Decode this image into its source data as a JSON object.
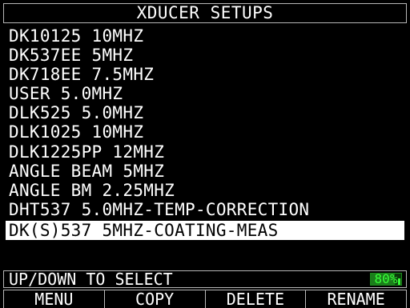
{
  "header": {
    "title": "XDUCER SETUPS"
  },
  "setups": {
    "items": [
      {
        "label": "DK10125 10MHZ"
      },
      {
        "label": "DK537EE 5MHZ"
      },
      {
        "label": "DK718EE 7.5MHZ"
      },
      {
        "label": "USER 5.0MHZ"
      },
      {
        "label": "DLK525 5.0MHZ"
      },
      {
        "label": "DLK1025 10MHZ"
      },
      {
        "label": "DLK1225PP 12MHZ"
      },
      {
        "label": "ANGLE BEAM 5MHZ"
      },
      {
        "label": "ANGLE BM 2.25MHZ"
      },
      {
        "label": "DHT537 5.0MHZ-TEMP-CORRECTION"
      },
      {
        "label": "DK(S)537 5MHZ-COATING-MEAS"
      }
    ],
    "selected_index": 10
  },
  "status": {
    "hint": "UP/DOWN TO SELECT",
    "battery_label": "80%",
    "battery_level": 0.8,
    "battery_color": "#38ff38"
  },
  "softkeys": {
    "menu": "MENU",
    "copy": "COPY",
    "delete": "DELETE",
    "rename": "RENAME"
  }
}
